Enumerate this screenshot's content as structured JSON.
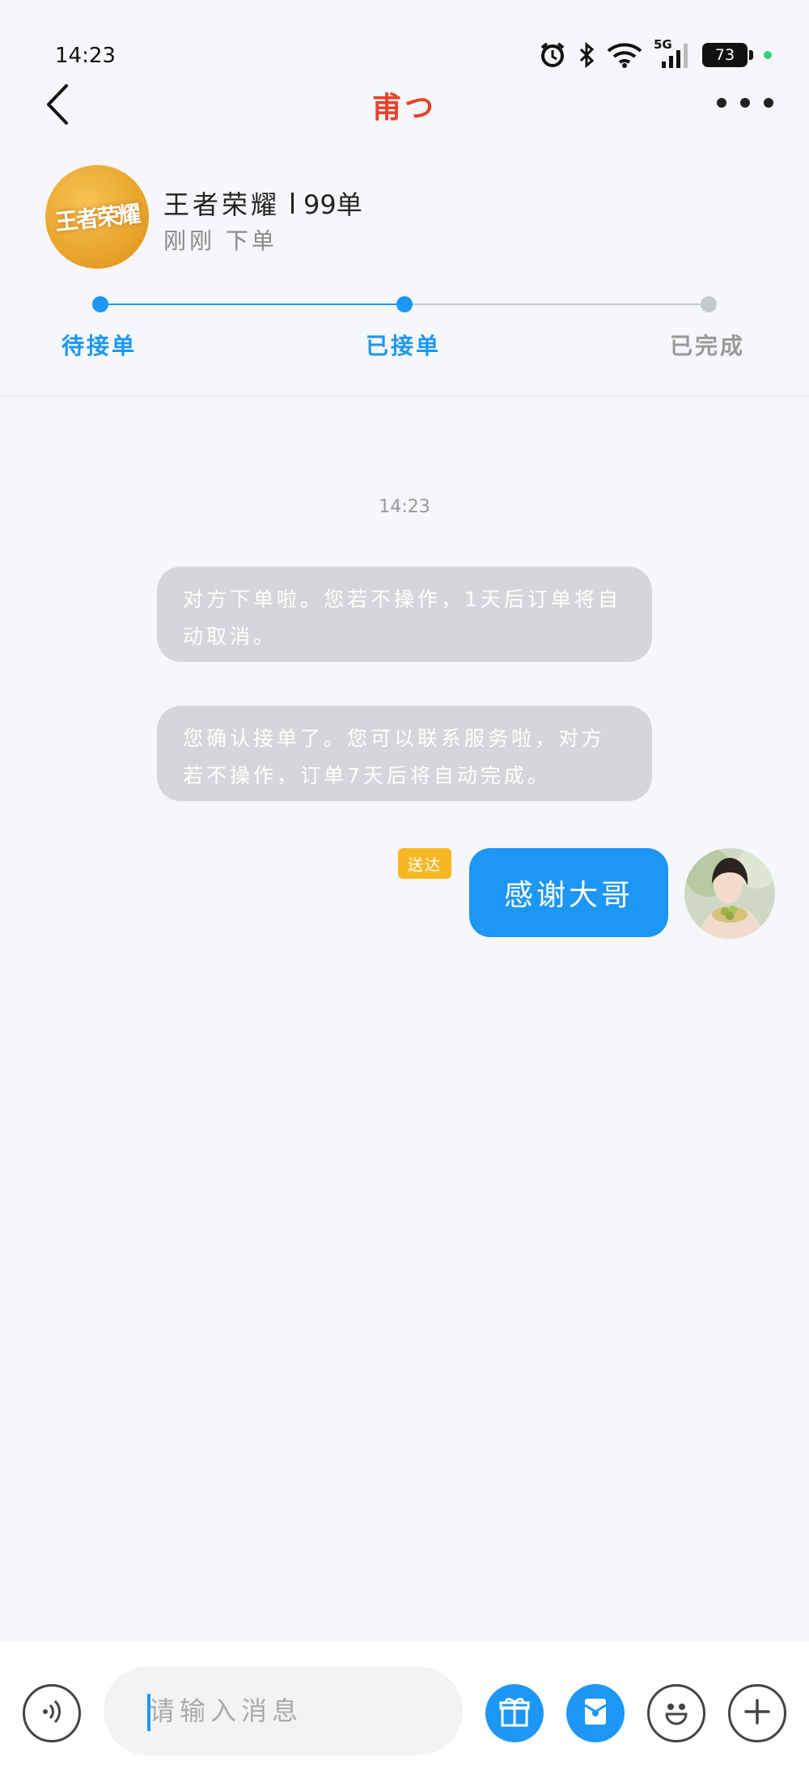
{
  "status_bar": {
    "time": "14:23",
    "network": "5G",
    "battery": "73"
  },
  "nav": {
    "title": "甫つ"
  },
  "order": {
    "game_logo_text": "王者荣耀",
    "game_name": "王者荣耀",
    "order_count": "99单",
    "order_time": "刚刚 下单",
    "steps": [
      {
        "label": "待接单",
        "state": "done"
      },
      {
        "label": "已接单",
        "state": "current"
      },
      {
        "label": "已完成",
        "state": "pending"
      }
    ]
  },
  "chat": {
    "time": "14:23",
    "system_messages": [
      "对方下单啦。您若不操作，1天后订单将自动取消。",
      "您确认接单了。您可以联系服务啦，对方若不操作，订单7天后将自动完成。"
    ],
    "my_message": {
      "badge": "送达",
      "text": "感谢大哥"
    }
  },
  "input_bar": {
    "placeholder": "请输入消息",
    "value": ""
  },
  "colors": {
    "accent": "#1d97f5",
    "title_red": "#e8432c",
    "badge_yellow": "#f7b824",
    "step_pending": "#c5c8cd",
    "system_bubble": "#d4d6d9"
  },
  "icons": [
    "back-icon",
    "more-icon",
    "alarm-icon",
    "bluetooth-icon",
    "wifi-icon",
    "signal-icon",
    "battery-icon",
    "voice-icon",
    "gift-icon",
    "red-packet-icon",
    "emoji-icon",
    "plus-icon"
  ]
}
